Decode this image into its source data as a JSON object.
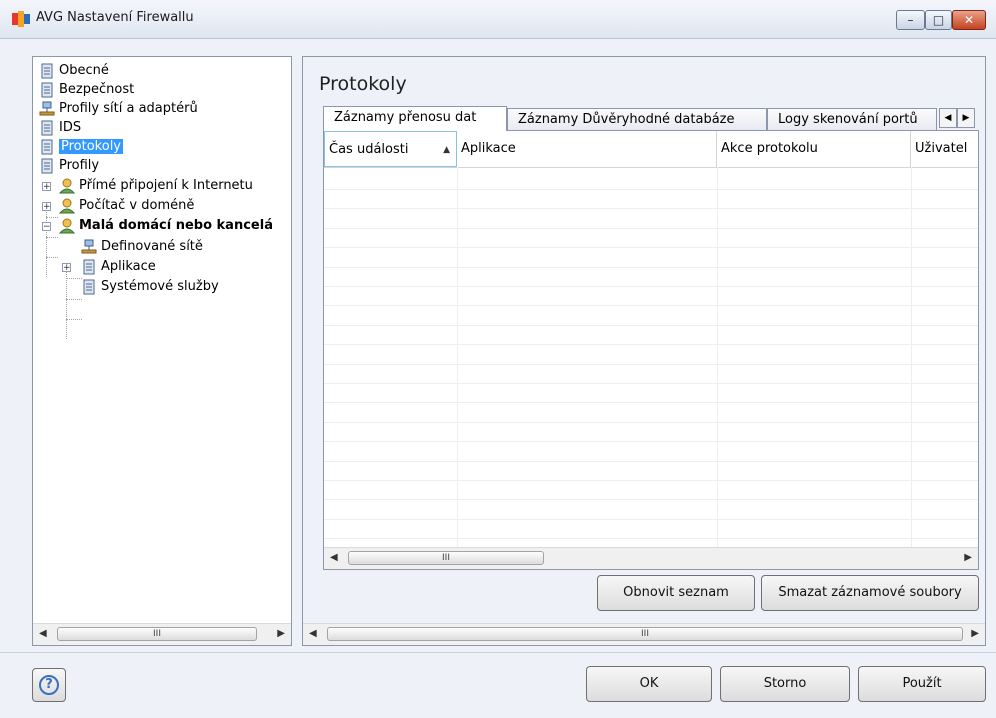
{
  "window": {
    "title": "AVG Nastavení Firewallu",
    "controls": {
      "minimize": "–",
      "maximize": "□",
      "close": "✕"
    }
  },
  "tree": {
    "items": [
      {
        "label": "Obecné",
        "icon": "document-icon"
      },
      {
        "label": "Bezpečnost",
        "icon": "document-icon"
      },
      {
        "label": "Profily sítí a adaptérů",
        "icon": "network-icon"
      },
      {
        "label": "IDS",
        "icon": "document-icon"
      },
      {
        "label": "Protokoly",
        "icon": "document-icon",
        "selected": true
      },
      {
        "label": "Profily",
        "icon": "document-icon"
      },
      {
        "label": "Přímé připojení k Internetu",
        "icon": "user-icon",
        "expander": "+"
      },
      {
        "label": "Počítač v doméně",
        "icon": "user-icon",
        "expander": "+"
      },
      {
        "label": "Malá domácí nebo kancelá",
        "icon": "user-icon",
        "expander": "−",
        "bold": true
      },
      {
        "label": "Definované sítě",
        "icon": "network-icon"
      },
      {
        "label": "Aplikace",
        "icon": "document-icon",
        "expander": "+"
      },
      {
        "label": "Systémové služby",
        "icon": "document-icon"
      }
    ],
    "scroll_thumb": "III"
  },
  "main": {
    "title": "Protokoly",
    "tabs": [
      {
        "label": "Záznamy přenosu dat",
        "active": true
      },
      {
        "label": "Záznamy Důvěryhodné databáze",
        "active": false
      },
      {
        "label": "Logy skenování portů",
        "active": false
      }
    ],
    "tab_scroll": {
      "left": "◀",
      "right": "▶"
    },
    "columns": [
      "Čas události",
      "Aplikace",
      "Akce protokolu",
      "Uživatel"
    ],
    "sort_indicator": "▲",
    "grid_scroll_thumb": "III",
    "panel_scroll_thumb": "III",
    "buttons": {
      "refresh": "Obnovit seznam",
      "delete_logs": "Smazat záznamové soubory"
    }
  },
  "footer": {
    "help": "?",
    "ok": "OK",
    "cancel": "Storno",
    "apply": "Použít"
  },
  "colors": {
    "selection": "#3399ff",
    "background": "#eef1f8",
    "border": "#8b97aa"
  }
}
